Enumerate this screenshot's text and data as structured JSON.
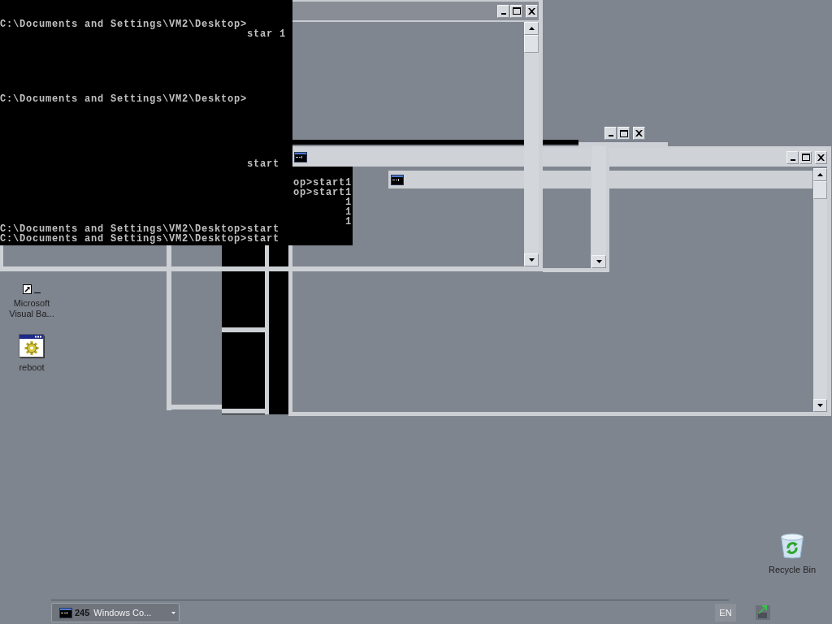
{
  "console_window": {
    "blocks": [
      [
        {
          "kind": "prompt",
          "text": "C:\\Documents and Settings\\VM2\\Desktop>"
        },
        {
          "kind": "continuation",
          "text": "star 1"
        }
      ],
      [
        {
          "kind": "prompt",
          "text": "C:\\Documents and Settings\\VM2\\Desktop>"
        }
      ],
      [
        {
          "kind": "continuation",
          "text": "start"
        }
      ],
      [
        {
          "kind": "prompt",
          "text": "C:\\Documents and Settings\\VM2\\Desktop>start"
        },
        {
          "kind": "prompt",
          "text": "C:\\Documents and Settings\\VM2\\Desktop>start"
        }
      ]
    ]
  },
  "console_fragment": {
    "lines": [
      "op>start1",
      "op>start1",
      "1",
      "1",
      "1"
    ]
  },
  "desktop_icons": [
    {
      "kind": "shortcut",
      "label": "Microsoft Visual Ba..."
    },
    {
      "kind": "program",
      "label": "reboot"
    }
  ],
  "recycle_bin": {
    "label": "Recycle Bin"
  },
  "taskbar": {
    "task_button": {
      "count": "245",
      "label": "Windows Co..."
    },
    "language": "EN"
  }
}
